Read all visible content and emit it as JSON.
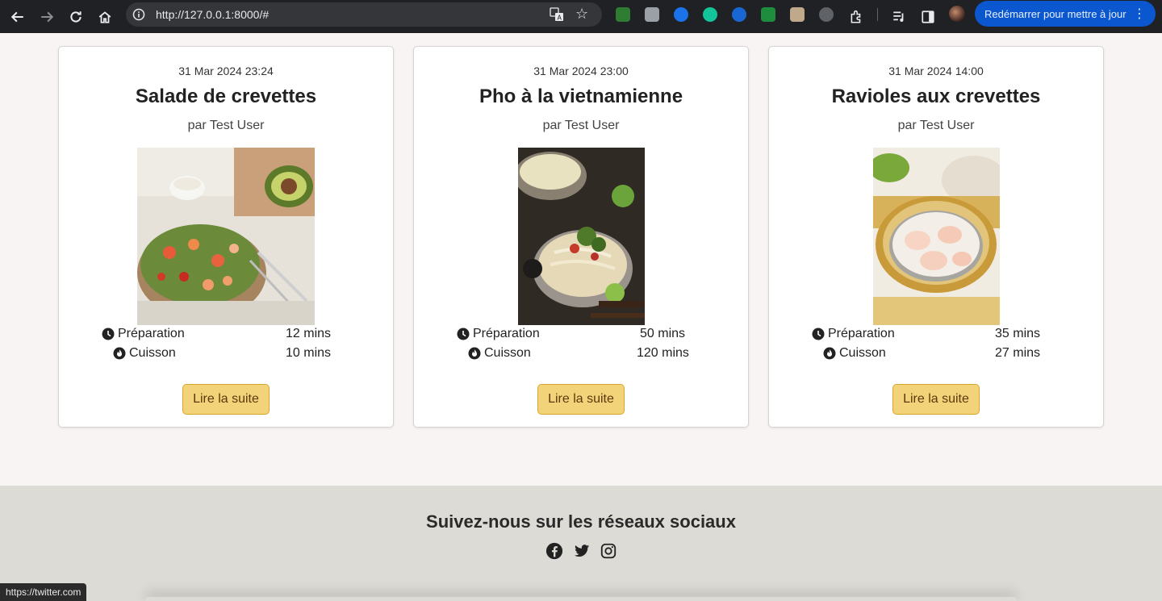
{
  "browser": {
    "url": "http://127.0.0.1:8000/#",
    "update_label": "Redémarrer pour mettre à jour",
    "status_url": "https://twitter.com"
  },
  "recipes": [
    {
      "date": "31 Mar 2024 23:24",
      "title": "Salade de crevettes",
      "author": "par Test User",
      "prep_label": "Préparation",
      "prep_value": "12 mins",
      "cook_label": "Cuisson",
      "cook_value": "10 mins",
      "button": "Lire la suite"
    },
    {
      "date": "31 Mar 2024 23:00",
      "title": "Pho à la vietnamienne",
      "author": "par Test User",
      "prep_label": "Préparation",
      "prep_value": "50 mins",
      "cook_label": "Cuisson",
      "cook_value": "120 mins",
      "button": "Lire la suite"
    },
    {
      "date": "31 Mar 2024 14:00",
      "title": "Ravioles aux crevettes",
      "author": "par Test User",
      "prep_label": "Préparation",
      "prep_value": "35 mins",
      "cook_label": "Cuisson",
      "cook_value": "27 mins",
      "button": "Lire la suite"
    }
  ],
  "footer": {
    "heading": "Suivez-nous sur les réseaux sociaux",
    "icons": [
      "facebook-icon",
      "twitter-icon",
      "instagram-icon"
    ]
  },
  "colors": {
    "page_bg": "#f8f4f3",
    "button_bg": "#f3d37a",
    "button_border": "#d9a62c",
    "footer_bg": "#dddbd6",
    "update_btn": "#0b57d0"
  }
}
